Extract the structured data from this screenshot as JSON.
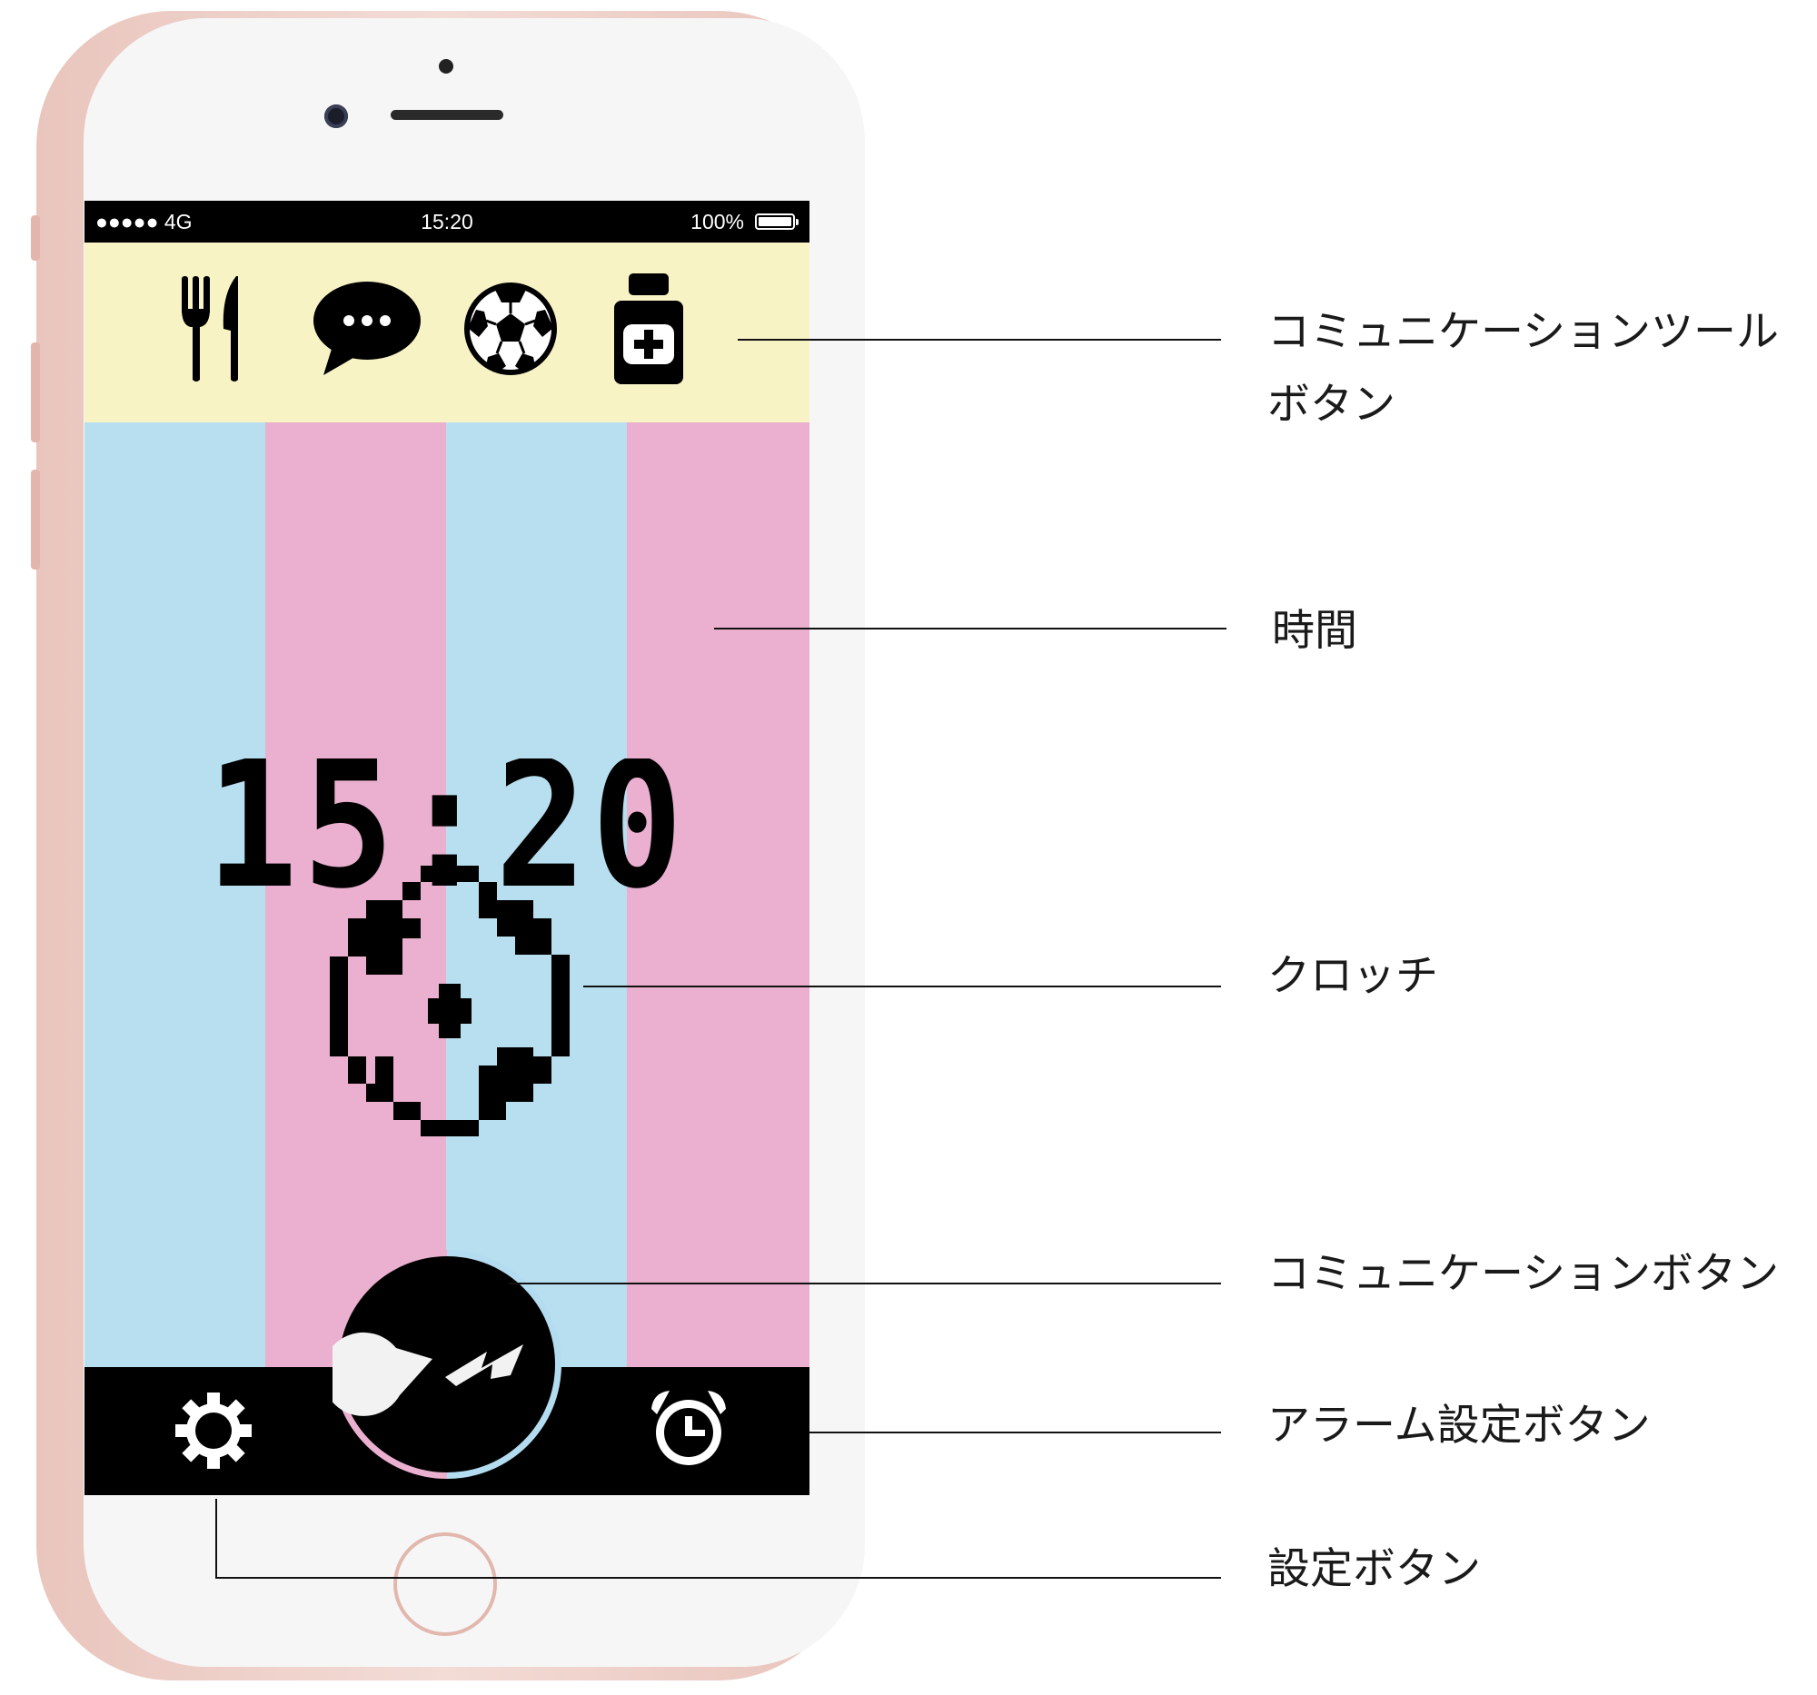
{
  "status_bar": {
    "signal": "●●●●● 4G",
    "time": "15:20",
    "battery": "100%"
  },
  "tool_bar": {
    "buttons": [
      {
        "icon": "fork-knife-icon"
      },
      {
        "icon": "speech-bubble-icon"
      },
      {
        "icon": "soccer-ball-icon"
      },
      {
        "icon": "medicine-bottle-icon"
      }
    ],
    "background_color": "#f7f3c5"
  },
  "clock": {
    "time": "15:20"
  },
  "stripe_colors": [
    "#b7dff0",
    "#ebb0cf"
  ],
  "bottom_bar": {
    "settings_icon": "gear-icon",
    "alarm_icon": "alarm-clock-icon",
    "communication_icon": "pacman-lightning-icon"
  },
  "callouts": {
    "communication_tool_buttons_line1": "コミュニケーションツール",
    "communication_tool_buttons_line2": "ボタン",
    "time": "時間",
    "clocchi": "クロッチ",
    "communication_button": "コミュニケーションボタン",
    "alarm_settings_button": "アラーム設定ボタン",
    "settings_button": "設定ボタン"
  }
}
